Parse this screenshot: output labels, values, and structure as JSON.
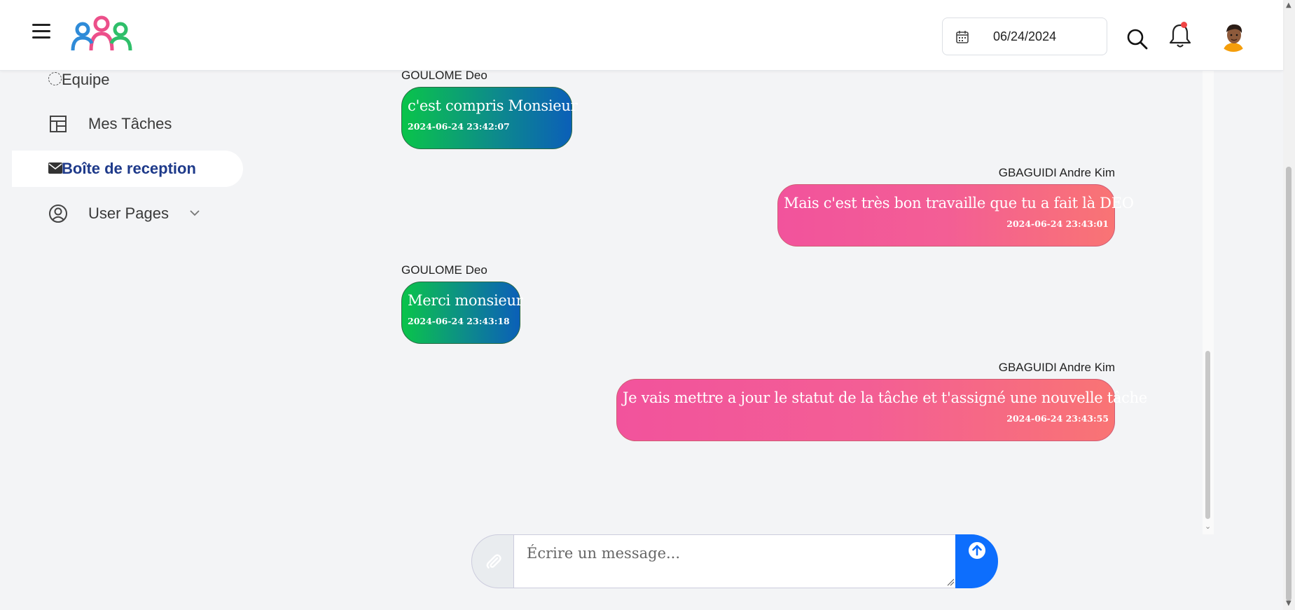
{
  "header": {
    "date_value": "06/24/2024",
    "icons": {
      "menu": "hamburger-menu-icon",
      "logo": "team-logo",
      "calendar": "calendar-icon",
      "search": "search-icon",
      "notifications": "bell-icon",
      "avatar": "user-avatar"
    },
    "notification_dot_color": "#ef4444"
  },
  "sidebar": {
    "items": [
      {
        "label": "Equipe",
        "icon": "circle-icon",
        "active": false
      },
      {
        "label": "Mes Tâches",
        "icon": "layout-icon",
        "active": false
      },
      {
        "label": "Boîte de reception",
        "icon": "envelope-icon",
        "active": true
      },
      {
        "label": "User Pages",
        "icon": "user-circle-icon",
        "active": false,
        "expandable": true
      }
    ]
  },
  "chat": {
    "messages": [
      {
        "sender": "GOULOME Deo",
        "text": "c'est compris Monsieur",
        "time": "2024-06-24 23:42:07",
        "direction": "received"
      },
      {
        "sender": "GBAGUIDI Andre Kim",
        "text": "Mais c'est très bon travaille que tu a fait là DEO",
        "time": "2024-06-24 23:43:01",
        "direction": "sent"
      },
      {
        "sender": "GOULOME Deo",
        "text": "Merci monsieur",
        "time": "2024-06-24 23:43:18",
        "direction": "received"
      },
      {
        "sender": "GBAGUIDI Andre Kim",
        "text": "Je vais mettre a jour le statut de la tâche et t'assigné une nouvelle tâche",
        "time": "2024-06-24 23:43:55",
        "direction": "sent"
      }
    ]
  },
  "composer": {
    "placeholder": "Écrire un message...",
    "attach_icon": "paperclip-icon",
    "send_icon": "arrow-up-circle-icon"
  },
  "colors": {
    "accent": "#0d6efd",
    "active_nav": "#1e3a8a",
    "received_gradient": [
      "#0ac44a",
      "#0b5fb8"
    ],
    "sent_gradient": [
      "#f2539c",
      "#f97474"
    ]
  }
}
